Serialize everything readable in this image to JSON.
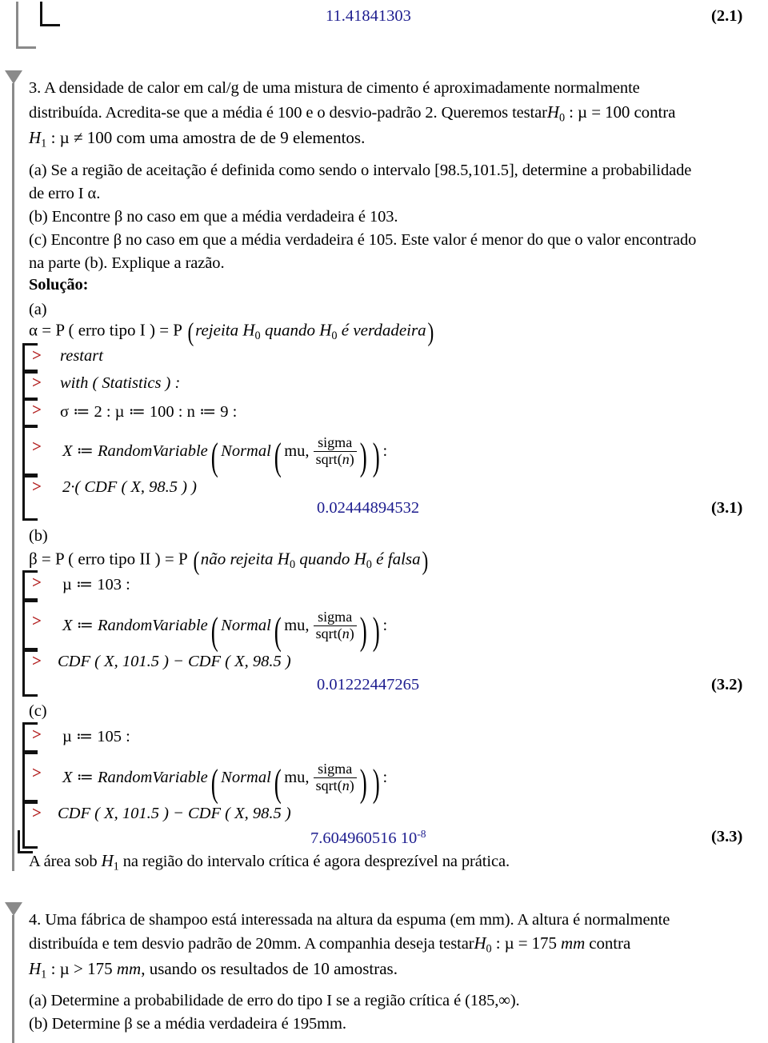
{
  "document": {
    "type": "maple-worksheet",
    "colors": {
      "result_blue": "#1d1d8f",
      "prompt_red": "#b32020",
      "gutter_gray": "#8a8a8a",
      "text_black": "#000000"
    }
  },
  "top_result": {
    "value": "11.41841303",
    "label": "(2.1)"
  },
  "problem3": {
    "marker": "section-triangle",
    "lines": [
      "3. A densidade de calor em cal/g de uma mistura de cimento é aproximadamente normalmente",
      "distribuída. Acredita-se que a média é 100 e o desvio-padrão 2. Queremos testar",
      "com uma amostra de de 9 elementos.",
      "(a) Se a região de aceitação  é definida como sendo o intervalo [98.5,101.5], determine a probabilidade",
      "de erro I α.",
      "(b) Encontre β no caso em que a média verdadeira é 103.",
      "(c) Encontre β no caso em que a média verdadeira é 105. Este valor é menor do que o valor encontrado",
      "na parte (b). Explique a razão."
    ],
    "h0_inline": "H",
    "h0_sub": "0",
    "h0_rest": " : µ = 100 contra",
    "h1_inline": "H",
    "h1_sub": "1",
    "h1_rest": " : µ ≠ 100 com uma amostra de de 9 elementos.",
    "solution_heading": "Solução:"
  },
  "part_a": {
    "label": "(a)",
    "definition": {
      "lhs": "α = P ( erro tipo I ) = P",
      "inner_pre": "rejeita H",
      "inner_sub1": "0",
      "inner_mid": " quando H",
      "inner_sub2": "0",
      "inner_post": " é verdadeira"
    },
    "commands": [
      {
        "prompt": ">",
        "text": "restart"
      },
      {
        "prompt": ">",
        "text": "with ( Statistics ) :"
      },
      {
        "prompt": ">",
        "text": "σ ≔ 2 : µ ≔ 100 : n ≔ 9 :"
      },
      {
        "prompt": ">",
        "text": "X ≔ RandomVariable ( Normal ( mu, sigma/sqrt(n) ) ) :"
      },
      {
        "prompt": ">",
        "text": "2·( CDF ( X, 98.5 ) )"
      }
    ],
    "rv_parts": {
      "assign": "X ≔ ",
      "fn": "RandomVariable",
      "dist": "Normal",
      "arg_mu": "mu,",
      "num": "sigma",
      "den_fn": "sqrt",
      "den_arg": "n",
      "trailing": ":"
    },
    "cdf_call": "2·( CDF ( X, 98.5 ) )",
    "result": "0.02444894532",
    "result_label": "(3.1)"
  },
  "part_b": {
    "label": "(b)",
    "definition": {
      "lhs": "β = P ( erro tipo II ) = P",
      "inner_pre": "não rejeita H",
      "inner_sub1": "0",
      "inner_mid": " quando H",
      "inner_sub2": "0",
      "inner_post": " é falsa"
    },
    "mu_assign": "µ ≔ 103 :",
    "cdf_call": "CDF ( X, 101.5 ) − CDF ( X, 98.5 )",
    "result": "0.01222447265",
    "result_label": "(3.2)"
  },
  "part_c": {
    "label": "(c)",
    "mu_assign": "µ ≔ 105 :",
    "cdf_call": "CDF ( X, 101.5 ) − CDF ( X, 98.5 )",
    "result_mantissa": "7.604960516 10",
    "result_exponent": "-8",
    "result_label": "(3.3)",
    "closing_text_pre": "A área sob ",
    "closing_text_h": "H",
    "closing_text_sub": "1",
    "closing_text_post": " na região do intervalo crítica é agora desprezível na prática."
  },
  "problem4": {
    "marker": "section-triangle",
    "line1": "4. Uma fábrica de shampoo está interessada na altura da espuma (em mm). A altura é normalmente",
    "line2_pre": "distribuída e tem desvio padrão de 20mm. A companhia deseja testar",
    "h0": "H",
    "h0_sub": "0",
    "h0_rest": " : µ = 175 ",
    "h0_units": "mm",
    "h0_tail": " contra",
    "h1": "H",
    "h1_sub": "1",
    "h1_rest": " : µ > 175 ",
    "h1_units": "mm",
    "h1_tail": ", usando os resultados de 10 amostras.",
    "item_a": "(a) Determine a probabilidade de erro do tipo I se a região crítica é (185,∞).",
    "item_b": "(b) Determine β se a média verdadeira é 195mm."
  }
}
